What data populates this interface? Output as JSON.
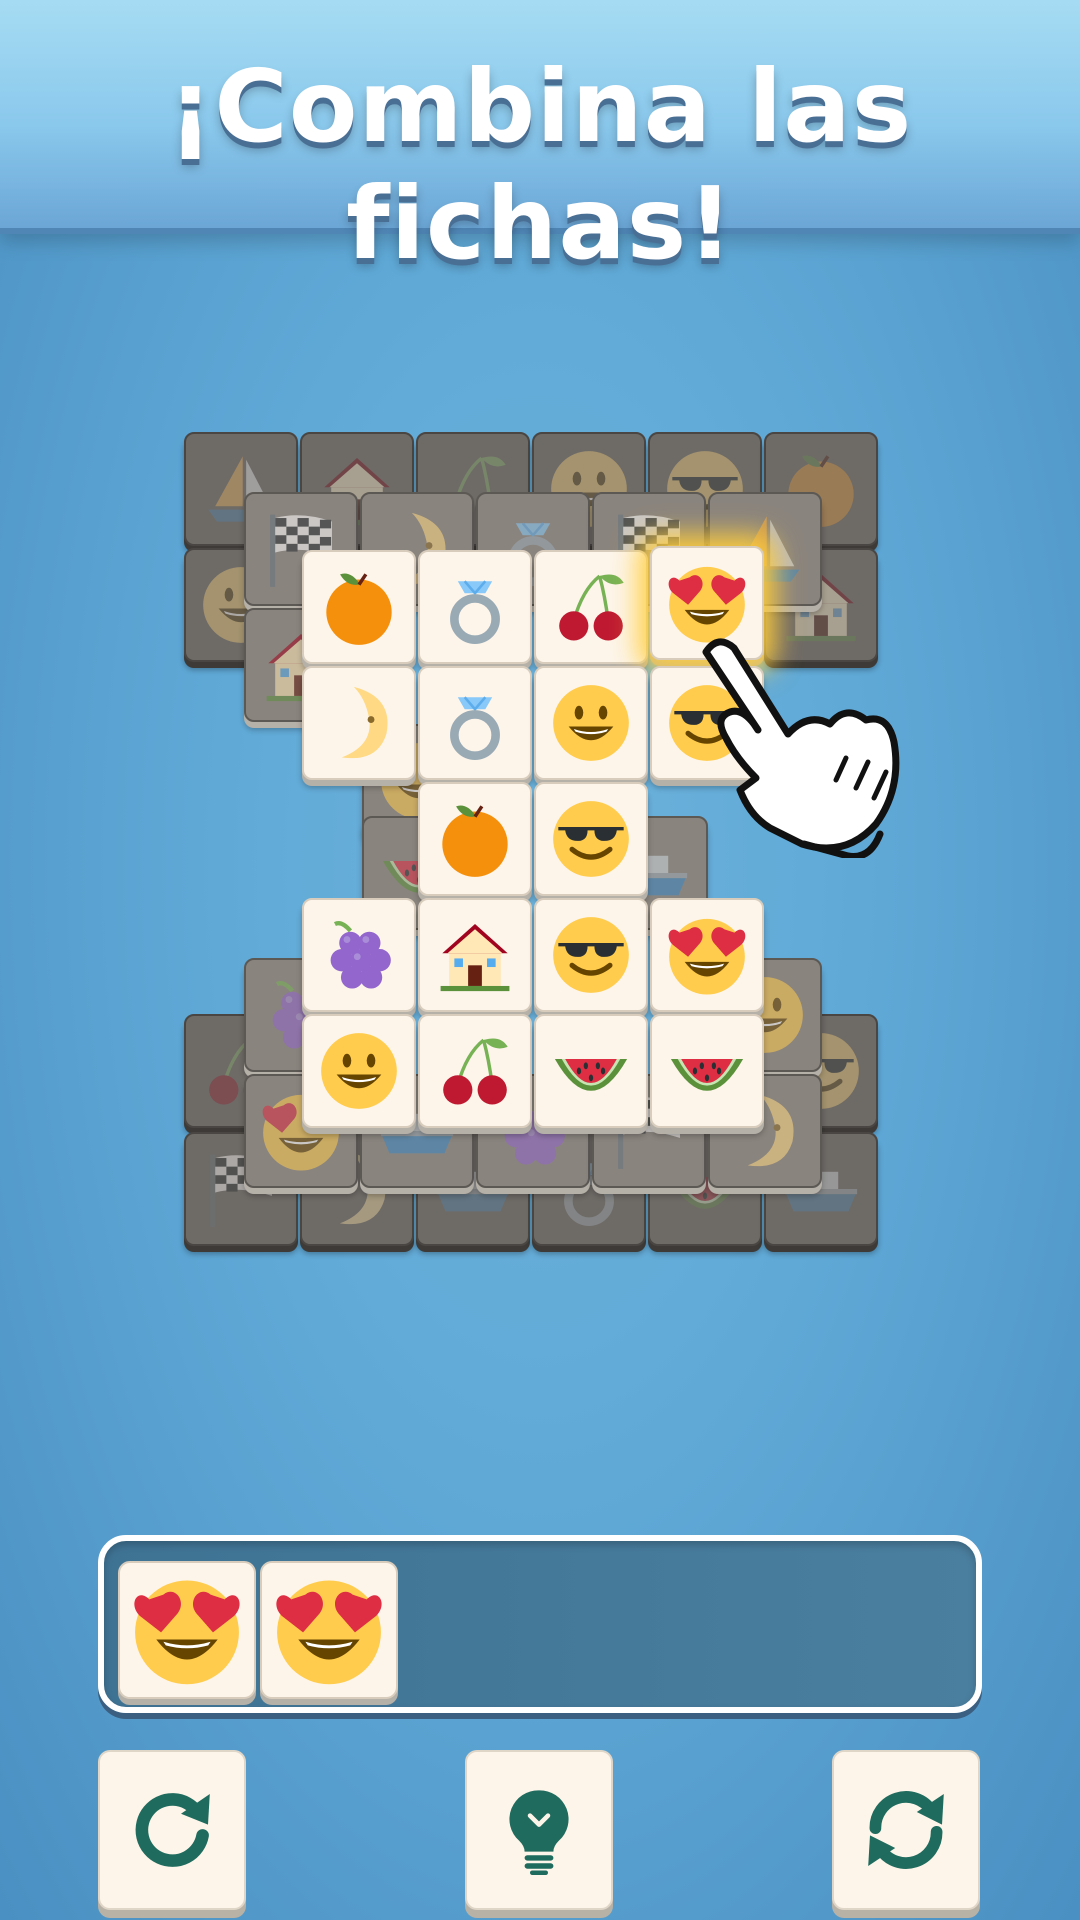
{
  "header": {
    "title": "¡Combina las fichas!"
  },
  "board": {
    "layer_bottom_row1": [
      "sailboat-icon",
      "house-icon",
      "cherries-icon",
      "smiley-icon",
      "sunglasses-smiley-icon",
      "orange-icon"
    ],
    "layer_bottom_row2": [
      "smiley-icon",
      "",
      "",
      "",
      "",
      "house-icon"
    ],
    "layer_bottom_row_last": [
      "checkered-flag-icon",
      "moon-icon",
      "ship-icon",
      "ring-icon",
      "watermelon-icon",
      "ship-icon"
    ],
    "top_row1": [
      "orange-icon",
      "ring-icon",
      "cherries-icon",
      "heart-eyes-icon"
    ],
    "top_row2": [
      "moon-icon",
      "ring-icon",
      "smiley-icon",
      "sunglasses-smiley-icon"
    ],
    "top_row3": [
      "orange-icon",
      "sunglasses-smiley-icon"
    ],
    "top_row4": [
      "grapes-icon",
      "house-icon",
      "sunglasses-smiley-icon",
      "heart-eyes-icon"
    ],
    "top_row5": [
      "smiley-icon",
      "cherries-icon",
      "watermelon-icon",
      "watermelon-icon"
    ],
    "selected_tile": "heart-eyes-icon"
  },
  "tray": {
    "capacity": 7,
    "items": [
      "heart-eyes-icon",
      "heart-eyes-icon"
    ]
  },
  "buttons": [
    {
      "name": "undo-button",
      "icon": "undo-arrow-icon"
    },
    {
      "name": "hint-button",
      "icon": "lightbulb-icon"
    },
    {
      "name": "shuffle-button",
      "icon": "shuffle-arrows-icon"
    }
  ],
  "colors": {
    "accent": "#1f6b5e",
    "tile": "#fdf5ea",
    "background": "#5fa8d6",
    "tray": "#4a7d9d"
  }
}
